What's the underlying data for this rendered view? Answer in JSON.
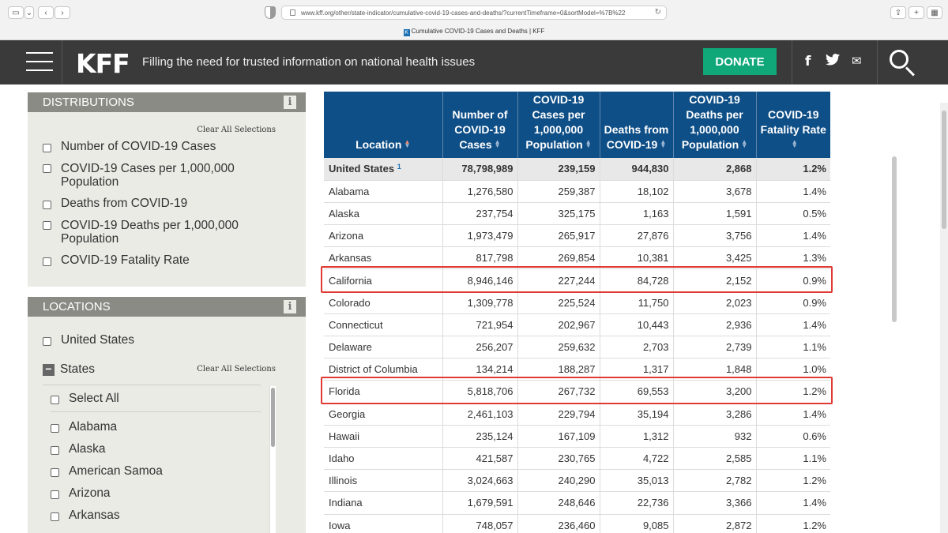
{
  "browser": {
    "url": "www.kff.org/other/state-indicator/cumulative-covid-19-cases-and-deaths/?currentTimeframe=0&sortModel=%7B%22",
    "tab_title": "Cumulative COVID-19 Cases and Deaths | KFF"
  },
  "header": {
    "logo": "KFF",
    "tagline": "Filling the need for trusted information on national health issues",
    "donate_label": "DONATE",
    "social": {
      "facebook": "f",
      "twitter": "🐦",
      "email": "✉"
    }
  },
  "sidebar": {
    "distributions": {
      "title": "DISTRIBUTIONS",
      "clear_label": "Clear All Selections",
      "options": [
        "Number of COVID-19 Cases",
        "COVID-19 Cases per 1,000,000 Population",
        "Deaths from COVID-19",
        "COVID-19 Deaths per 1,000,000 Population",
        "COVID-19 Fatality Rate"
      ]
    },
    "locations": {
      "title": "LOCATIONS",
      "united_states": "United States",
      "states_label": "States",
      "clear_label": "Clear All Selections",
      "select_all": "Select All",
      "states": [
        "Alabama",
        "Alaska",
        "American Samoa",
        "Arizona",
        "Arkansas"
      ]
    }
  },
  "table": {
    "headers": [
      "Location",
      "Number of COVID-19 Cases",
      "COVID-19 Cases per 1,000,000 Population",
      "Deaths from COVID-19",
      "COVID-19 Deaths per 1,000,000 Population",
      "COVID-19 Fatality Rate"
    ],
    "total": {
      "location": "United States",
      "footnote": "1",
      "cells": [
        "78,798,989",
        "239,159",
        "944,830",
        "2,868",
        "1.2%"
      ]
    },
    "rows": [
      [
        "Alabama",
        "1,276,580",
        "259,387",
        "18,102",
        "3,678",
        "1.4%"
      ],
      [
        "Alaska",
        "237,754",
        "325,175",
        "1,163",
        "1,591",
        "0.5%"
      ],
      [
        "Arizona",
        "1,973,479",
        "265,917",
        "27,876",
        "3,756",
        "1.4%"
      ],
      [
        "Arkansas",
        "817,798",
        "269,854",
        "10,381",
        "3,425",
        "1.3%"
      ],
      [
        "California",
        "8,946,146",
        "227,244",
        "84,728",
        "2,152",
        "0.9%"
      ],
      [
        "Colorado",
        "1,309,778",
        "225,524",
        "11,750",
        "2,023",
        "0.9%"
      ],
      [
        "Connecticut",
        "721,954",
        "202,967",
        "10,443",
        "2,936",
        "1.4%"
      ],
      [
        "Delaware",
        "256,207",
        "259,632",
        "2,703",
        "2,739",
        "1.1%"
      ],
      [
        "District of Columbia",
        "134,214",
        "188,287",
        "1,317",
        "1,848",
        "1.0%"
      ],
      [
        "Florida",
        "5,818,706",
        "267,732",
        "69,553",
        "3,200",
        "1.2%"
      ],
      [
        "Georgia",
        "2,461,103",
        "229,794",
        "35,194",
        "3,286",
        "1.4%"
      ],
      [
        "Hawaii",
        "235,124",
        "167,109",
        "1,312",
        "932",
        "0.6%"
      ],
      [
        "Idaho",
        "421,587",
        "230,765",
        "4,722",
        "2,585",
        "1.1%"
      ],
      [
        "Illinois",
        "3,024,663",
        "240,290",
        "35,013",
        "2,782",
        "1.2%"
      ],
      [
        "Indiana",
        "1,679,591",
        "248,646",
        "22,736",
        "3,366",
        "1.4%"
      ],
      [
        "Iowa",
        "748,057",
        "236,460",
        "9,085",
        "2,872",
        "1.2%"
      ]
    ],
    "highlighted_rows": [
      "California",
      "Florida"
    ],
    "highlight_color": "#e03a34",
    "header_color": "#0f4f87"
  }
}
